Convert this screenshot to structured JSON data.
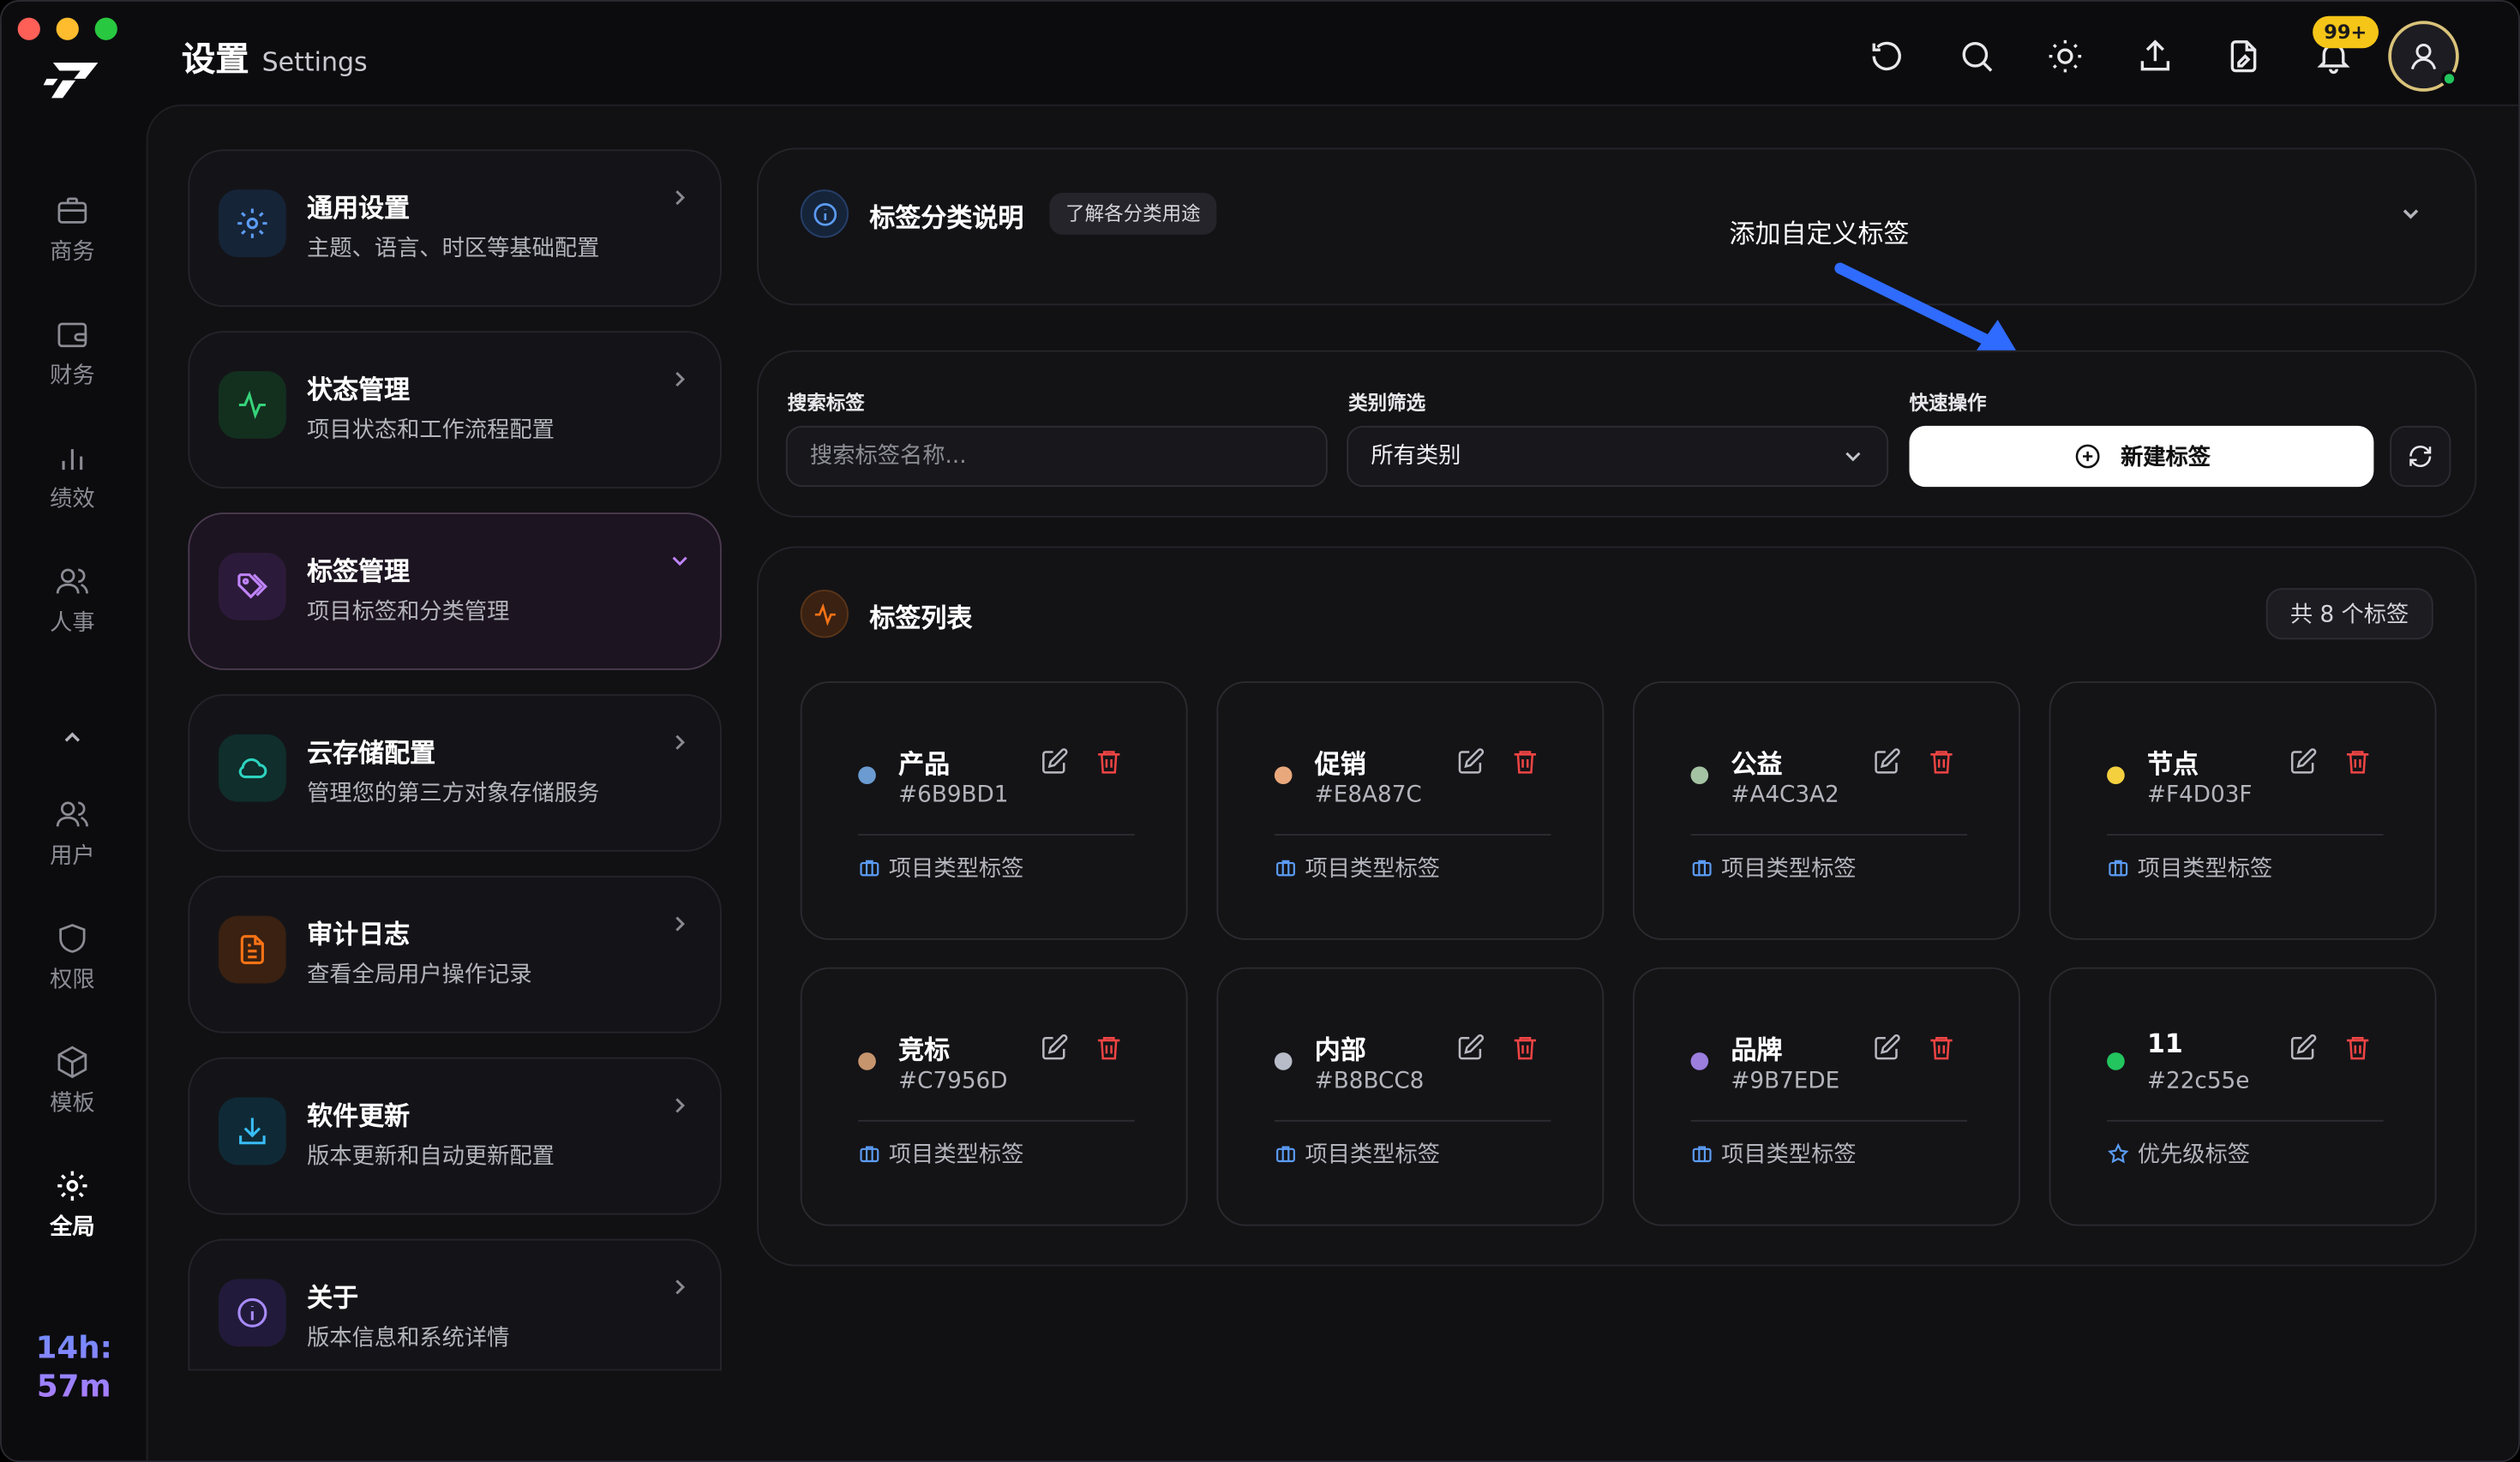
{
  "app": {
    "title": "设置",
    "subtitle": "Settings"
  },
  "rail": {
    "items": [
      {
        "label": "商务",
        "icon": "briefcase-icon"
      },
      {
        "label": "财务",
        "icon": "wallet-icon"
      },
      {
        "label": "绩效",
        "icon": "bar-chart-icon"
      },
      {
        "label": "人事",
        "icon": "people-icon"
      },
      {
        "label": "用户",
        "icon": "user-icon"
      },
      {
        "label": "权限",
        "icon": "shield-icon"
      },
      {
        "label": "模板",
        "icon": "cube-icon"
      },
      {
        "label": "全局",
        "icon": "gear-icon"
      }
    ],
    "timer": "14h:\n57m"
  },
  "header": {
    "notification_badge": "99+"
  },
  "menu": [
    {
      "title": "通用设置",
      "subtitle": "主题、语言、时区等基础配置"
    },
    {
      "title": "状态管理",
      "subtitle": "项目状态和工作流程配置"
    },
    {
      "title": "标签管理",
      "subtitle": "项目标签和分类管理"
    },
    {
      "title": "云存储配置",
      "subtitle": "管理您的第三方对象存储服务"
    },
    {
      "title": "审计日志",
      "subtitle": "查看全局用户操作记录"
    },
    {
      "title": "软件更新",
      "subtitle": "版本更新和自动更新配置"
    },
    {
      "title": "关于",
      "subtitle": "版本信息和系统详情"
    }
  ],
  "info_card": {
    "title": "标签分类说明",
    "pill": "了解各分类用途",
    "annotation": "添加自定义标签"
  },
  "filters": {
    "search_label": "搜索标签",
    "search_placeholder": "搜索标签名称...",
    "category_label": "类别筛选",
    "category_value": "所有类别",
    "quick_label": "快速操作",
    "new_button": "新建标签"
  },
  "tag_list": {
    "title": "标签列表",
    "count": "共 8 个标签",
    "tags": [
      {
        "name": "产品",
        "hex": "#6B9BD1",
        "color": "#6B9BD1",
        "category": "项目类型标签"
      },
      {
        "name": "促销",
        "hex": "#E8A87C",
        "color": "#E8A87C",
        "category": "项目类型标签"
      },
      {
        "name": "公益",
        "hex": "#A4C3A2",
        "color": "#A4C3A2",
        "category": "项目类型标签"
      },
      {
        "name": "节点",
        "hex": "#F4D03F",
        "color": "#F4D03F",
        "category": "项目类型标签"
      },
      {
        "name": "竞标",
        "hex": "#C7956D",
        "color": "#C7956D",
        "category": "项目类型标签"
      },
      {
        "name": "内部",
        "hex": "#B8BCC8",
        "color": "#B8BCC8",
        "category": "项目类型标签"
      },
      {
        "name": "品牌",
        "hex": "#9B7EDE",
        "color": "#9B7EDE",
        "category": "项目类型标签"
      },
      {
        "name": "11",
        "hex": "#22c55e",
        "color": "#22c55e",
        "category": "优先级标签"
      }
    ]
  }
}
